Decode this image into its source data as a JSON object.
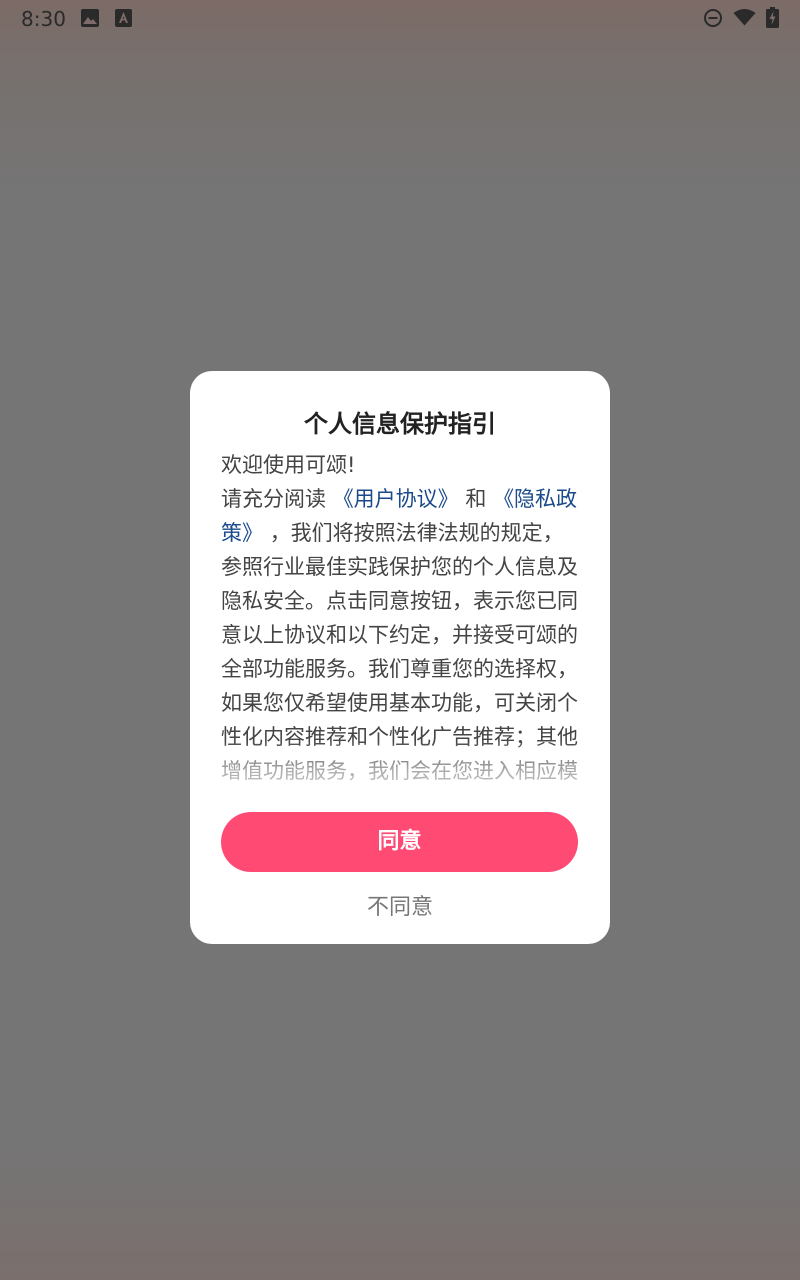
{
  "status_bar": {
    "time": "8:30",
    "left_icons": [
      "image-icon",
      "font-a-icon"
    ],
    "right_icons": [
      "do-not-disturb-icon",
      "wifi-icon",
      "battery-charging-icon"
    ]
  },
  "dialog": {
    "title": "个人信息保护指引",
    "greeting": "欢迎使用可颂!",
    "body_prefix": "请充分阅读",
    "user_agreement_link": "《用户协议》",
    "and_word": "和",
    "privacy_policy_link": "《隐私政策》",
    "body_text": "，我们将按照法律法规的规定，参照行业最佳实践保护您的个人信息及隐私安全。点击同意按钮，表示您已同意以上协议和以下约定，并接受可颂的全部功能服务。我们尊重您的选择权，如果您仅希望使用基本功能，可关闭个性化内容推荐和个性化广告推荐；其他增值功能服务，我们会在您进入相应模",
    "agree_label": "同意",
    "disagree_label": "不同意"
  },
  "colors": {
    "accent": "#ff4a74",
    "link": "#1a4a8a",
    "scrim": "#757575"
  }
}
